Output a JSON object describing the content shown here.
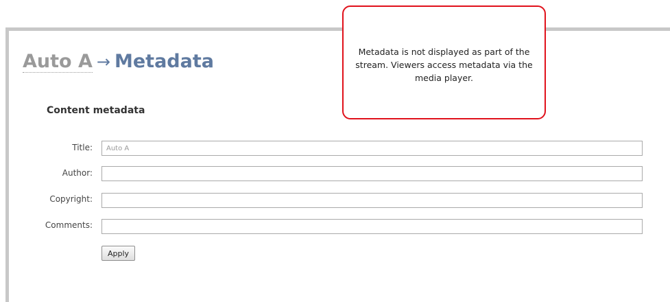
{
  "breadcrumb": {
    "parent": "Auto A",
    "separator": "→",
    "current": "Metadata"
  },
  "section_title": "Content metadata",
  "fields": [
    {
      "label": "Title:",
      "value": "Auto A"
    },
    {
      "label": "Author:",
      "value": ""
    },
    {
      "label": "Copyright:",
      "value": ""
    },
    {
      "label": "Comments:",
      "value": ""
    }
  ],
  "apply_label": "Apply",
  "callout": {
    "text": "Metadata is not displayed as part of the stream. Viewers access metadata via the media player.",
    "border_color": "#e0101a"
  },
  "colors": {
    "heading_current": "#5f7aa0",
    "heading_parent": "#9a9a9a",
    "frame": "#c8c8c8"
  }
}
